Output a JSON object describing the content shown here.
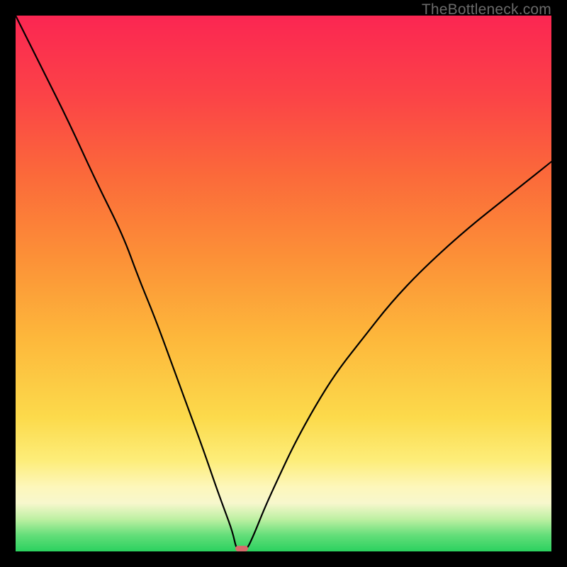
{
  "watermark": "TheBottleneck.com",
  "chart_data": {
    "type": "line",
    "title": "",
    "xlabel": "",
    "ylabel": "",
    "xlim": [
      0,
      100
    ],
    "ylim": [
      0,
      110
    ],
    "gradient_bands": [
      {
        "offset": 0.0,
        "color": "#2bd15f"
      },
      {
        "offset": 0.03,
        "color": "#63de79"
      },
      {
        "offset": 0.06,
        "color": "#bdf0a2"
      },
      {
        "offset": 0.09,
        "color": "#f7f7cd"
      },
      {
        "offset": 0.12,
        "color": "#fdf7bb"
      },
      {
        "offset": 0.17,
        "color": "#fded79"
      },
      {
        "offset": 0.25,
        "color": "#fcda4b"
      },
      {
        "offset": 0.4,
        "color": "#fdb73b"
      },
      {
        "offset": 0.55,
        "color": "#fc9037"
      },
      {
        "offset": 0.7,
        "color": "#fb6a3a"
      },
      {
        "offset": 0.85,
        "color": "#fb4347"
      },
      {
        "offset": 1.0,
        "color": "#fb2652"
      }
    ],
    "series": [
      {
        "name": "bottleneck-curve",
        "color": "#000000",
        "width": 2.2,
        "x": [
          0,
          5,
          10,
          15,
          20,
          23,
          26,
          29,
          32,
          35,
          37.5,
          39,
          40.5,
          41.3,
          43,
          44.5,
          46.5,
          49,
          52,
          56,
          60,
          65,
          70,
          76,
          84,
          92,
          100
        ],
        "y": [
          110,
          99,
          88,
          76,
          65,
          56,
          48,
          39,
          30,
          21,
          13,
          8.5,
          4.0,
          0.0,
          0.0,
          3.5,
          9.0,
          15,
          22,
          30,
          37,
          44,
          51,
          58,
          66,
          73,
          80
        ]
      }
    ],
    "marker": {
      "x": 42.2,
      "y": 0.6,
      "w": 2.4,
      "h": 1.2,
      "color": "#d66b6b"
    }
  }
}
